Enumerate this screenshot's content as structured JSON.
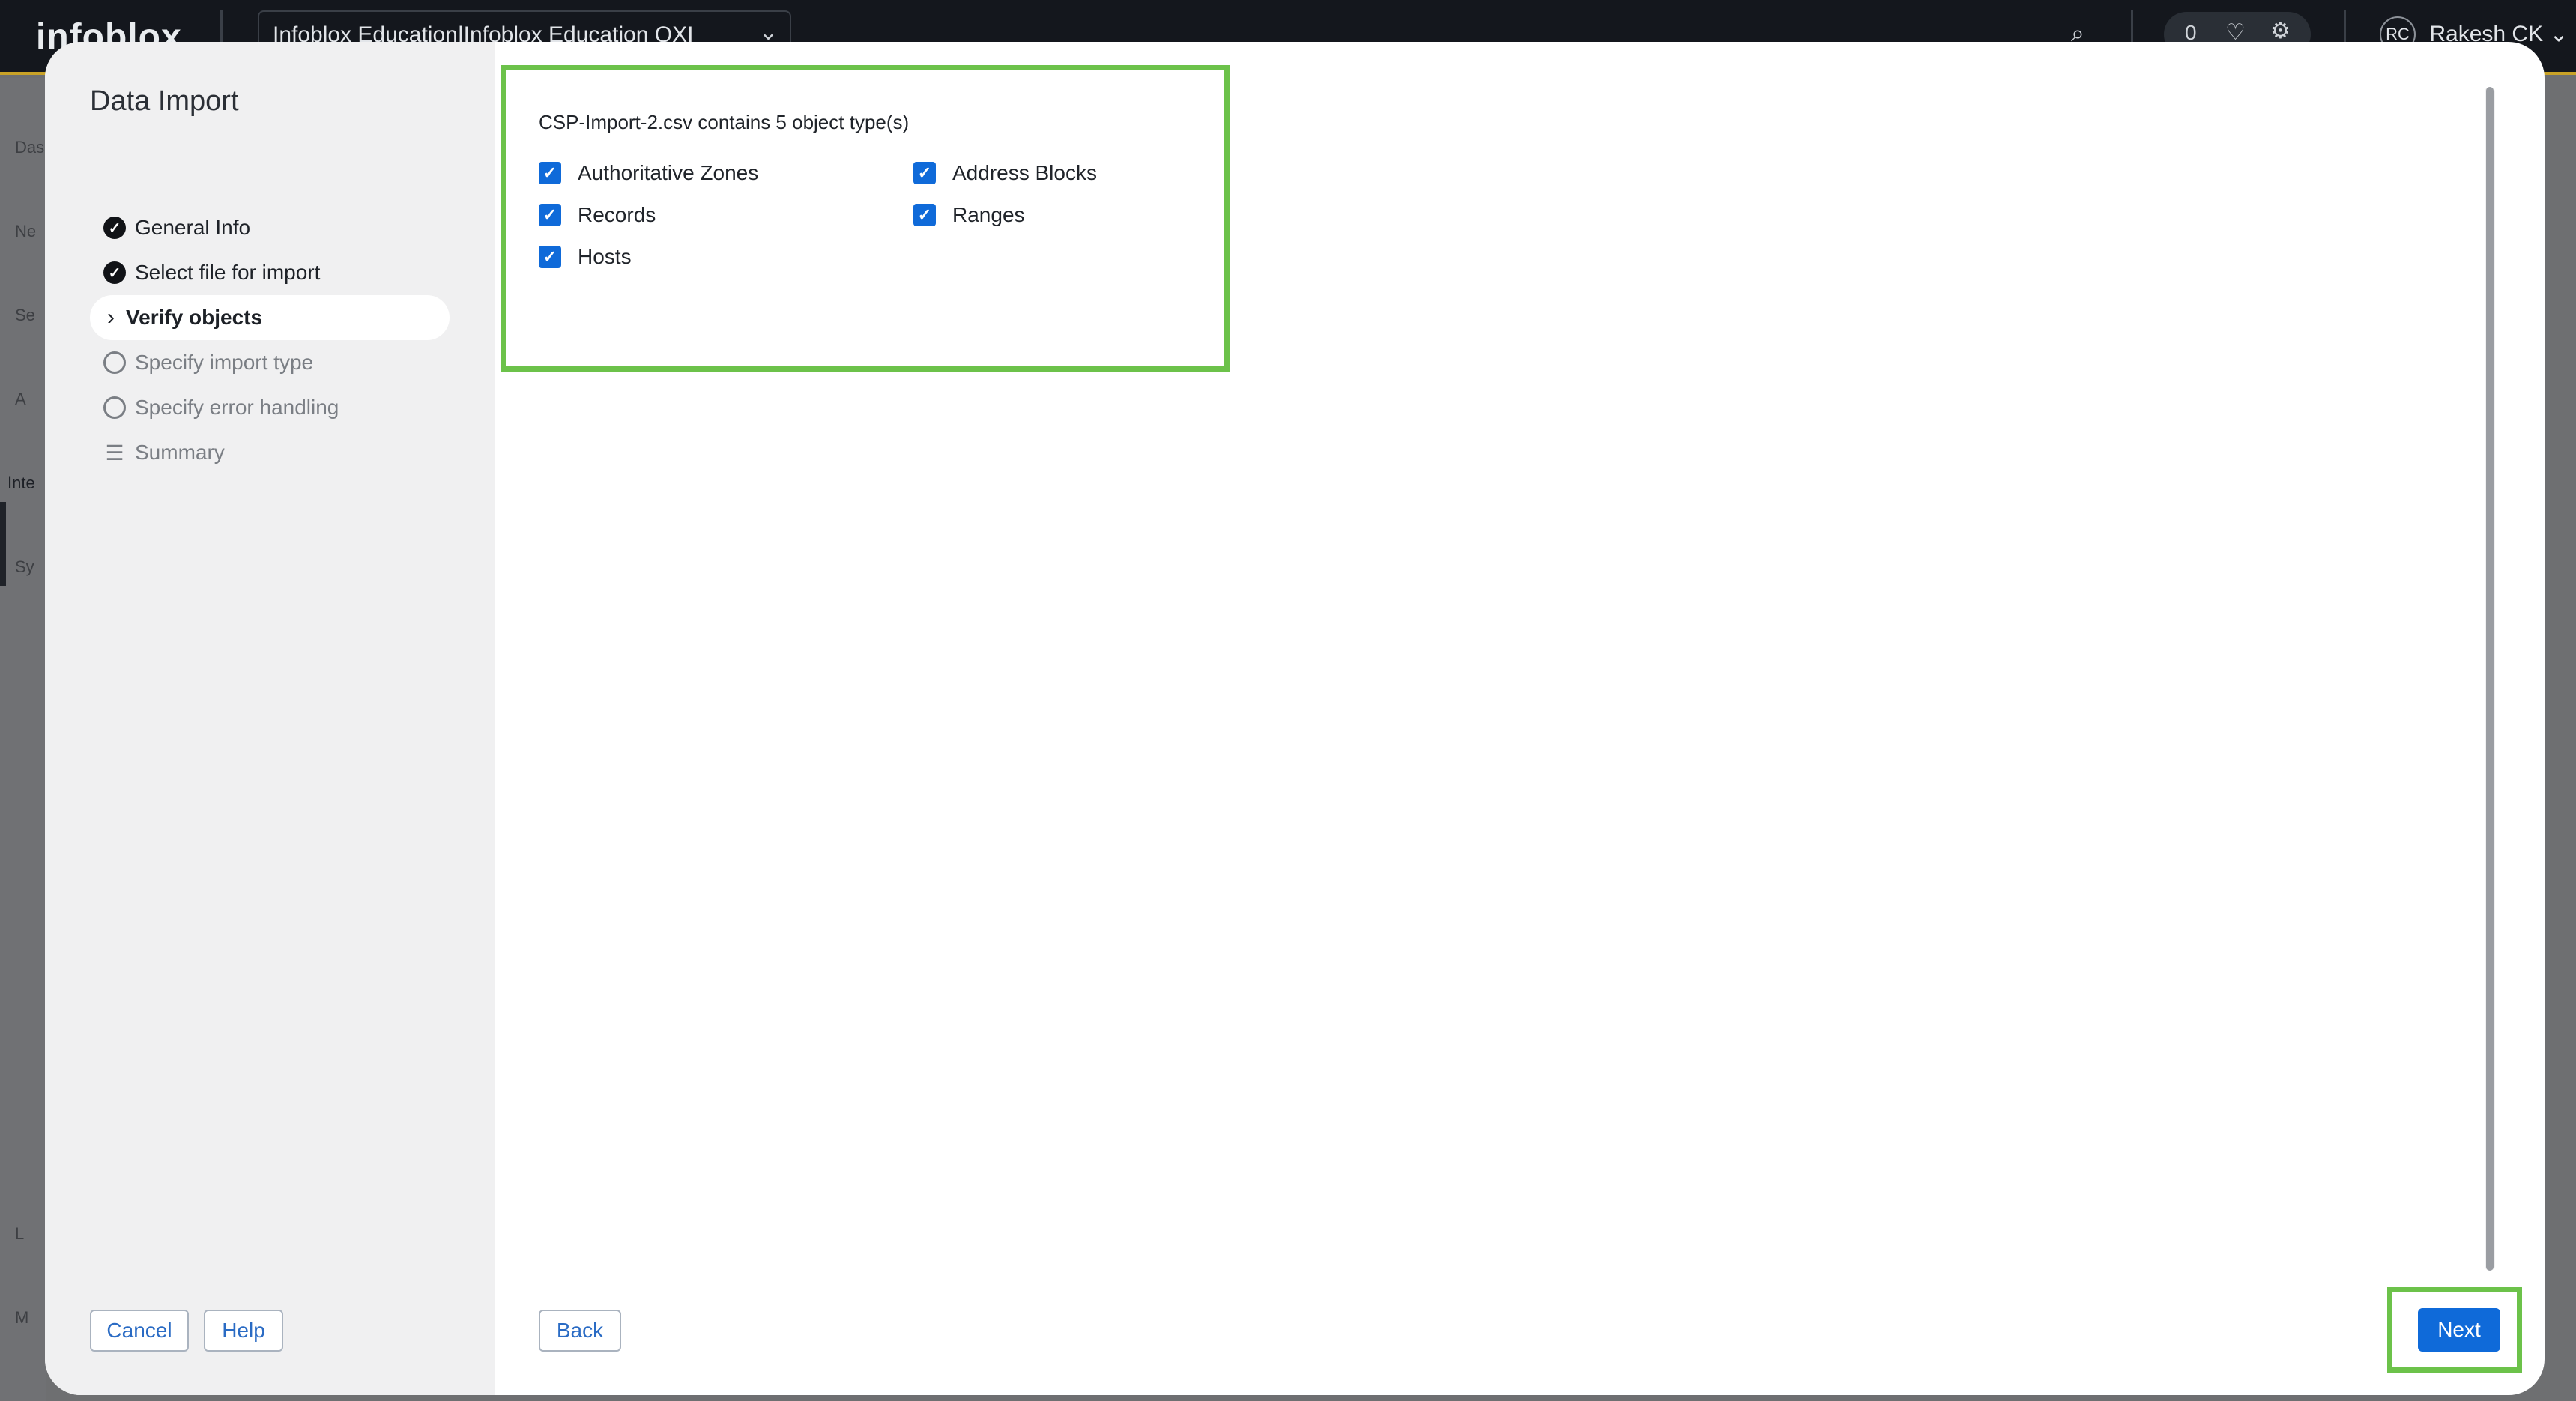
{
  "background_app": {
    "logo": "infoblox",
    "tenant": "Infoblox Education|Infoblox Education QXI",
    "notification_count": "0",
    "user": "Rakesh CK",
    "user_initials": "RC",
    "sidebar_stubs": [
      "Das",
      "Ne",
      "Se",
      "A",
      "Inte",
      "Sy",
      "L",
      "M"
    ]
  },
  "modal": {
    "title": "Data Import",
    "steps": [
      {
        "label": "General Info",
        "state": "done"
      },
      {
        "label": "Select file for import",
        "state": "done"
      },
      {
        "label": "Verify objects",
        "state": "active"
      },
      {
        "label": "Specify import type",
        "state": "pending"
      },
      {
        "label": "Specify error handling",
        "state": "pending"
      },
      {
        "label": "Summary",
        "state": "pending"
      }
    ],
    "content": {
      "summary": "CSP-Import-2.csv contains 5 object type(s)",
      "object_types": [
        {
          "label": "Authoritative Zones",
          "checked": true
        },
        {
          "label": "Address Blocks",
          "checked": true
        },
        {
          "label": "Records",
          "checked": true
        },
        {
          "label": "Ranges",
          "checked": true
        },
        {
          "label": "Hosts",
          "checked": true
        }
      ]
    },
    "buttons": {
      "cancel": "Cancel",
      "help": "Help",
      "back": "Back",
      "next": "Next"
    }
  },
  "colors": {
    "primary": "#0f6ad9",
    "highlight": "#6cc24a",
    "left_pane": "#f0f0f1"
  }
}
